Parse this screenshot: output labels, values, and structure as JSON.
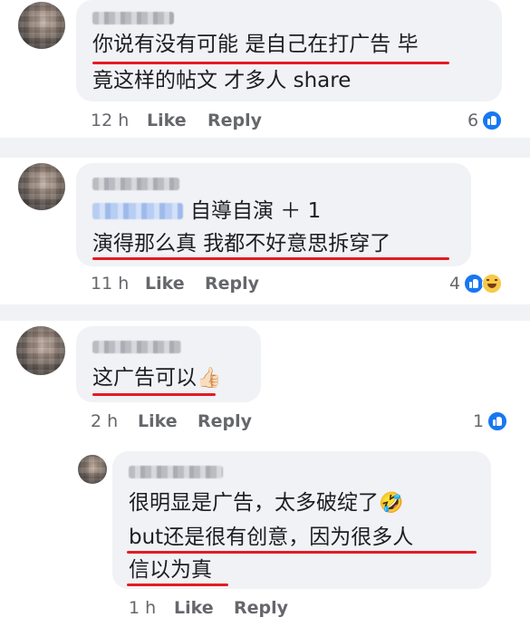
{
  "comments": [
    {
      "name": "[blurred name]",
      "lines": [
        "你说有没有可能 是自己在打广告 毕",
        "竟这样的帖文 才多人 share"
      ],
      "time": "12 h",
      "like": "Like",
      "reply": "Reply",
      "reaction_count": "6",
      "reactions": [
        "like-icon"
      ]
    },
    {
      "name": "[blurred name]",
      "tagged_name": "[blurred tag]",
      "lines": [
        "自導自演 ＋ 1",
        "演得那么真 我都不好意思拆穿了"
      ],
      "time": "11 h",
      "like": "Like",
      "reply": "Reply",
      "reaction_count": "4",
      "reactions": [
        "like-icon",
        "haha-icon"
      ]
    },
    {
      "name": "[blurred name]",
      "lines": [
        "这广告可以"
      ],
      "emoji": "👍🏻",
      "time": "2 h",
      "like": "Like",
      "reply": "Reply",
      "reaction_count": "1",
      "reactions": [
        "like-icon"
      ]
    },
    {
      "name": "[blurred name]",
      "lines": [
        "很明显是广告，太多破绽了",
        "but还是很有创意，因为很多人",
        "信以为真"
      ],
      "emoji": "🤣",
      "time": "1 h",
      "like": "Like",
      "reply": "Reply"
    }
  ],
  "colors": {
    "highlight_underline": "#e41b23",
    "bubble": "#f0f2f5",
    "separator": "#f0f2f5",
    "like_blue": "#1877f2"
  }
}
